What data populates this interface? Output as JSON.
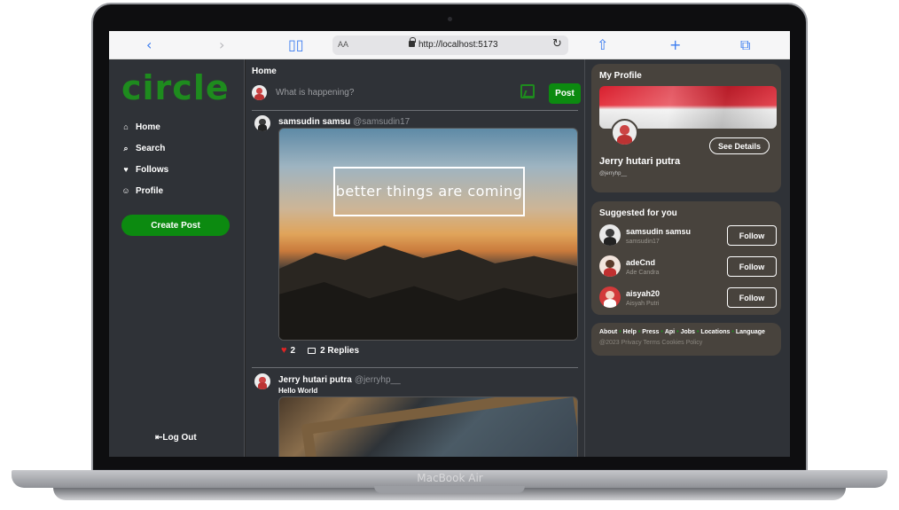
{
  "device": {
    "brand": "MacBook Air"
  },
  "browser": {
    "text_size_label": "AA",
    "url": "http://localhost:5173"
  },
  "app": {
    "logo": "circle",
    "nav": [
      {
        "label": "Home",
        "icon": "home-icon"
      },
      {
        "label": "Search",
        "icon": "search-icon"
      },
      {
        "label": "Follows",
        "icon": "heart-icon"
      },
      {
        "label": "Profile",
        "icon": "profile-icon"
      }
    ],
    "create_post_label": "Create Post",
    "logout_label": "Log Out",
    "accent_color": "#0c8a10"
  },
  "feed": {
    "title": "Home",
    "compose_placeholder": "What is happening?",
    "post_button": "Post",
    "posts": [
      {
        "name": "samsudin samsu",
        "handle": "@samsudin17",
        "text": "",
        "image_caption": "better things are coming",
        "likes": "2",
        "replies": "2 Replies"
      },
      {
        "name": "Jerry hutari putra",
        "handle": "@jerryhp__",
        "text": "Hello World"
      }
    ]
  },
  "profile": {
    "title": "My Profile",
    "see_details": "See Details",
    "name": "Jerry hutari putra",
    "handle": "@jerryhp__"
  },
  "suggested": {
    "title": "Suggested for you",
    "follow_label": "Follow",
    "users": [
      {
        "name": "samsudin samsu",
        "sub": "samsudin17"
      },
      {
        "name": "adeCnd",
        "sub": "Ade Candra"
      },
      {
        "name": "aisyah20",
        "sub": "Aisyah Putri"
      }
    ]
  },
  "footer": {
    "links": [
      "About",
      "Help",
      "Press",
      "Api",
      "Jobs",
      "Locations",
      "Language"
    ],
    "copyright": "@2023 Privacy Terms Cookies Policy"
  }
}
